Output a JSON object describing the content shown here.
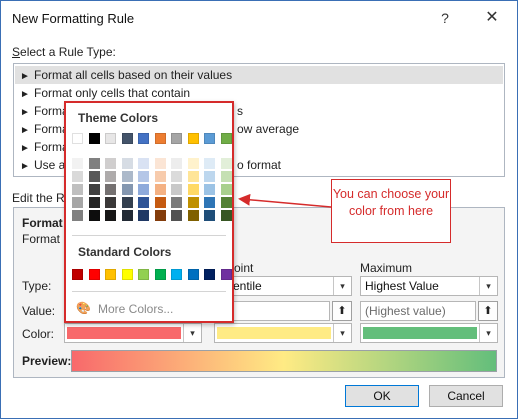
{
  "window": {
    "title": "New Formatting Rule",
    "help_label": "?",
    "close_label": "✕"
  },
  "rule_type": {
    "label_prefix": "S",
    "label_rest": "elect a Rule Type:",
    "items": [
      {
        "arrow": "►",
        "label": "Format all cells based on their values"
      },
      {
        "arrow": "►",
        "label": "Format only cells that contain"
      },
      {
        "arrow": "►",
        "label": "Forma"
      },
      {
        "arrow": "►",
        "label": "Forma"
      },
      {
        "arrow": "►",
        "label": "Forma"
      },
      {
        "arrow": "►",
        "label": "Use a"
      }
    ],
    "right_fragments": [
      "s",
      "ow average",
      "o format"
    ]
  },
  "edit": {
    "label_left": "Edit the R",
    "format_heading": "Format a",
    "format_style_label": "Format S",
    "midpoint_label": "oint",
    "maximum_label": "Maximum",
    "type_label": "Type:",
    "value_label": "Value:",
    "color_label": "Color:",
    "midpoint_type": "entile",
    "max_type": "Highest Value",
    "max_value_placeholder": "(Highest value)",
    "preview_label": "Preview:",
    "min_color": "#f8696b",
    "mid_color": "#ffeb84",
    "max_color": "#63be7b",
    "dropdown_arrow": "▾",
    "up_arrow": "⬆"
  },
  "buttons": {
    "ok": "OK",
    "cancel": "Cancel"
  },
  "palette": {
    "theme_heading": "Theme Colors",
    "standard_heading": "Standard Colors",
    "more_colors": "More Colors...",
    "more_icon": "🎨",
    "theme_colors": [
      "#ffffff",
      "#000000",
      "#e7e6e6",
      "#44546a",
      "#4472c4",
      "#ed7d31",
      "#a5a5a5",
      "#ffc000",
      "#5b9bd5",
      "#70ad47"
    ],
    "theme_shades": [
      [
        "#f2f2f2",
        "#d9d9d9",
        "#bfbfbf",
        "#a6a6a6",
        "#808080"
      ],
      [
        "#808080",
        "#595959",
        "#404040",
        "#262626",
        "#0d0d0d"
      ],
      [
        "#d0cece",
        "#aeabab",
        "#757171",
        "#3a3838",
        "#171616"
      ],
      [
        "#d6dce4",
        "#acb9ca",
        "#8497b0",
        "#333f4f",
        "#222a35"
      ],
      [
        "#d9e2f3",
        "#b4c6e7",
        "#8eaadb",
        "#2f5496",
        "#1f3864"
      ],
      [
        "#fbe5d5",
        "#f7cbac",
        "#f4b183",
        "#c55a11",
        "#833c0b"
      ],
      [
        "#ededed",
        "#dbdbdb",
        "#c9c9c9",
        "#7b7b7b",
        "#525252"
      ],
      [
        "#fff2cc",
        "#ffe598",
        "#ffd965",
        "#bf9000",
        "#7f6000"
      ],
      [
        "#deebf6",
        "#bdd7ee",
        "#9cc3e5",
        "#2e75b5",
        "#1f4e79"
      ],
      [
        "#e2efd9",
        "#c5e0b3",
        "#a8d08d",
        "#538135",
        "#375623"
      ]
    ],
    "standard_colors": [
      "#c00000",
      "#ff0000",
      "#ffc000",
      "#ffff00",
      "#92d050",
      "#00b050",
      "#00b0f0",
      "#0070c0",
      "#002060",
      "#7030a0"
    ]
  },
  "callout": {
    "text": "You can choose your color from here",
    "color": "#d52b2b"
  }
}
